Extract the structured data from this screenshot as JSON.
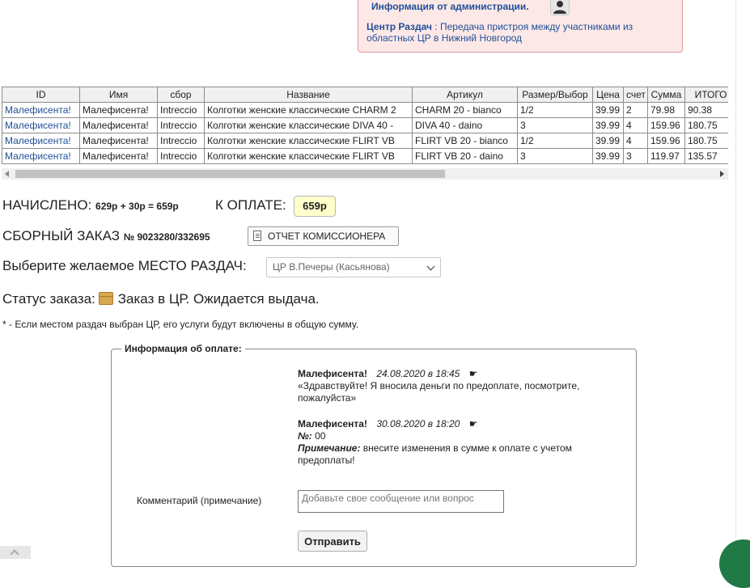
{
  "admin": {
    "title": "Информация от администрации.",
    "message_prefix": "Центр Раздач",
    "message_text": " : Передача пристроя между участниками из областных ЦР в Нижний Новгород"
  },
  "table": {
    "columns": [
      "ID",
      "Имя",
      "сбор",
      "Название",
      "Артикул",
      "Размер/Выбор",
      "Цена",
      "счет",
      "Сумма",
      "ИТОГО П"
    ],
    "rows": [
      [
        "Малефисента!",
        "Малефисента!",
        "Intreccio",
        "Колготки женские классические CHARM 2",
        "CHARM 20 - bianco",
        "1/2",
        "39.99",
        "2",
        "79.98",
        "90.38"
      ],
      [
        "Малефисента!",
        "Малефисента!",
        "Intreccio",
        "Колготки женские классические DIVA 40 -",
        "DIVA 40 - daino",
        "3",
        "39.99",
        "4",
        "159.96",
        "180.75"
      ],
      [
        "Малефисента!",
        "Малефисента!",
        "Intreccio",
        "Колготки женские классические FLIRT VB",
        "FLIRT VB 20 - bianco",
        "1/2",
        "39.99",
        "4",
        "159.96",
        "180.75"
      ],
      [
        "Малефисента!",
        "Малефисента!",
        "Intreccio",
        "Колготки женские классические FLIRT VB",
        "FLIRT VB 20 - daino",
        "3",
        "39.99",
        "3",
        "119.97",
        "135.57"
      ]
    ]
  },
  "summary": {
    "accrued_label": "НАЧИСЛЕНО:",
    "accrued_value": "629р + 30р = 659р",
    "to_pay_label": "К ОПЛАТЕ:",
    "to_pay_value": "659р",
    "order_label": "СБОРНЫЙ ЗАКАЗ",
    "order_number": "№ 9023280/332695",
    "report_button": "ОТЧЕТ КОМИССИОНЕРА",
    "pickup_label": "Выберите желаемое МЕСТО РАЗДАЧ:",
    "pickup_selected": "ЦР В.Печеры (Касьянова)",
    "status_label": "Статус заказа:",
    "status_value": "Заказ в ЦР. Ожидается выдача.",
    "note": "* - Если местом раздач выбран ЦР, его услуги будут включены в общую сумму."
  },
  "payment_info": {
    "legend": "Информация об оплате:",
    "messages": [
      {
        "author": "Малефисента!",
        "date": "24.08.2020 в 18:45",
        "pointer": "☛",
        "text": "«Здравствуйте! Я вносила деньги по предоплате, посмотрите, пожалуйста»"
      },
      {
        "author": "Малефисента!",
        "date": "30.08.2020 в 18:20",
        "pointer": "☛",
        "number_label": "№:",
        "number_value": " 00",
        "remark_label": "Примечание:",
        "remark_text": " внесите изменения в сумме к оплате с учетом предоплаты!"
      }
    ],
    "comment_label": "Комментарий (примечание)",
    "comment_placeholder": "Добавьте свое сообщение или вопрос",
    "send_button": "Отправить"
  },
  "icons": {
    "admin_avatar": "user-silhouette-icon",
    "report_doc": "document-icon",
    "status_box": "package-box-icon",
    "pointer": "pointing-hand-icon"
  }
}
